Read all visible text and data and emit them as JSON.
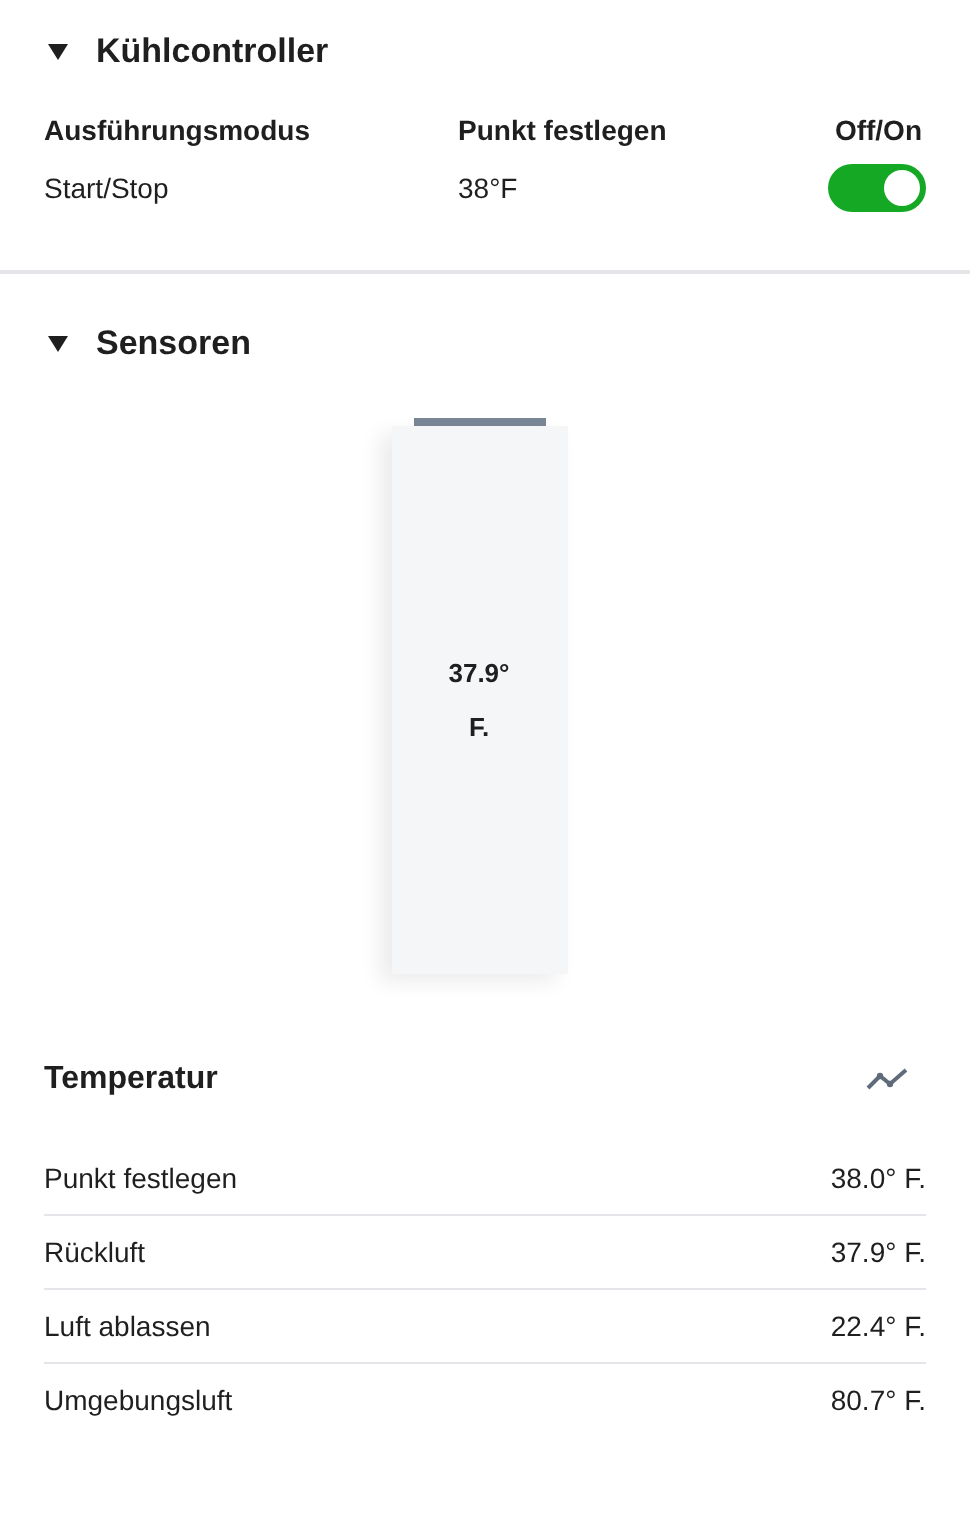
{
  "cooling_controller": {
    "title": "Kühlcontroller",
    "expanded": true,
    "columns": [
      "Ausführungsmodus",
      "Punkt festlegen",
      "Off/On"
    ],
    "row": {
      "mode": "Start/Stop",
      "setpoint": "38°F",
      "on": true
    }
  },
  "sensors": {
    "title": "Sensoren",
    "expanded": true,
    "gauge": {
      "reading_value": "37.9°",
      "reading_unit": "F."
    },
    "temperature": {
      "title": "Temperatur",
      "rows": [
        {
          "label": "Punkt festlegen",
          "value": "38.0° F."
        },
        {
          "label": "Rückluft",
          "value": "37.9° F."
        },
        {
          "label": "Luft ablassen",
          "value": "22.4° F."
        },
        {
          "label": "Umgebungsluft",
          "value": "80.7° F."
        }
      ]
    }
  }
}
